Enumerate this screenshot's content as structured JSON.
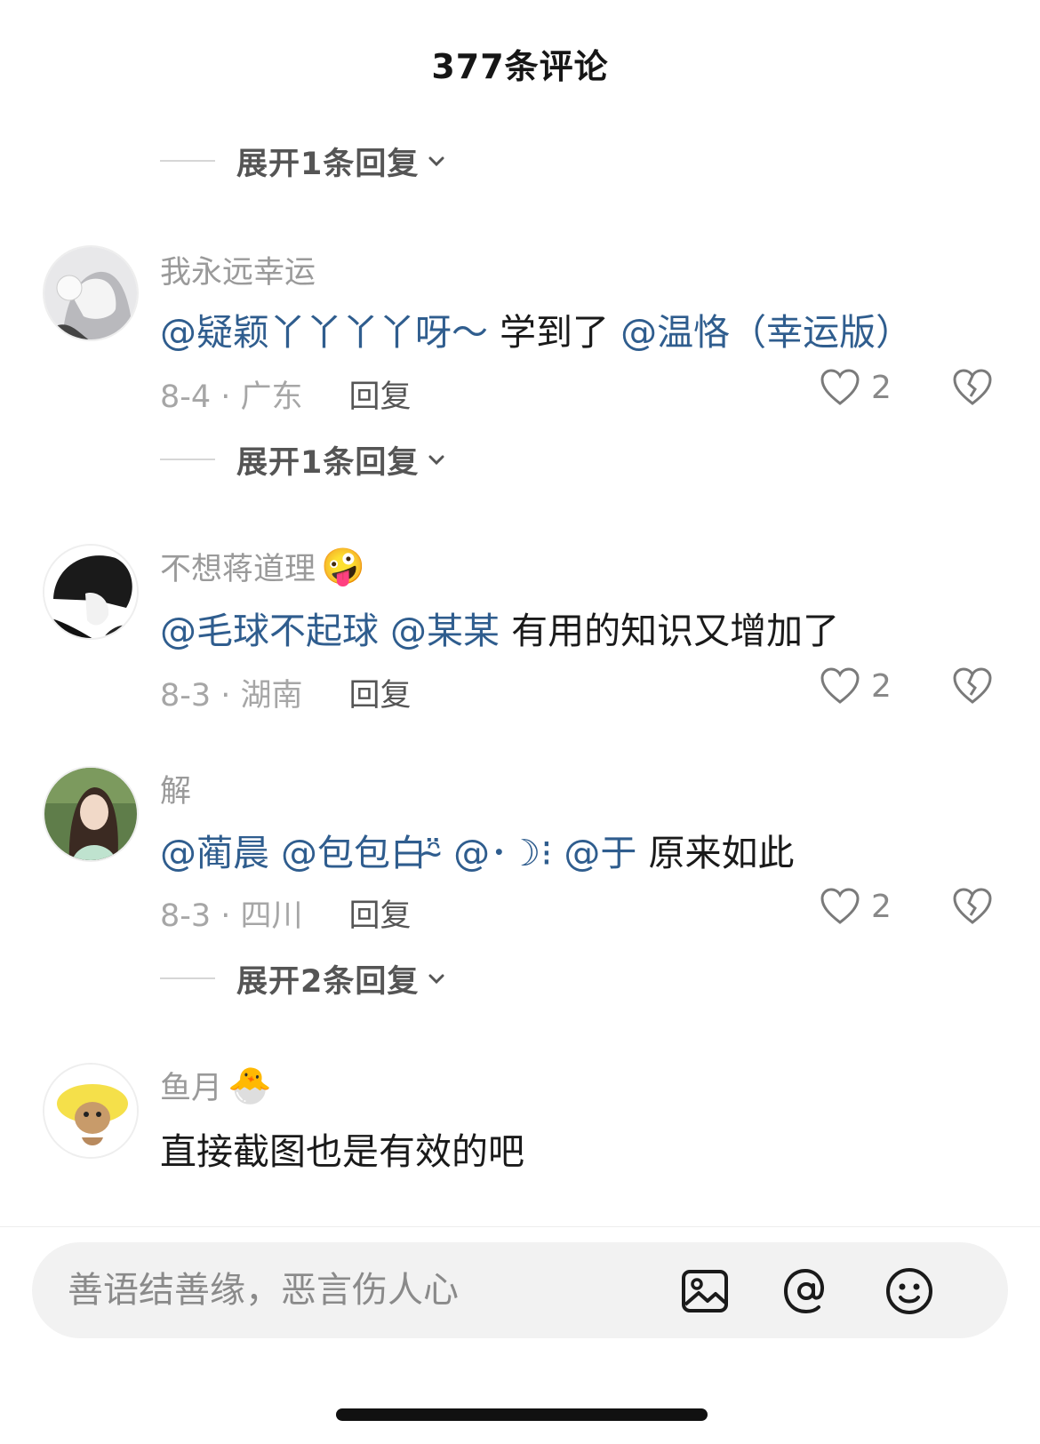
{
  "header": {
    "title": "377条评论"
  },
  "expand_replies": [
    {
      "label": "展开1条回复"
    },
    {
      "label": "展开1条回复"
    },
    {
      "label": "展开2条回复"
    }
  ],
  "comments": [
    {
      "username": "我永远幸运",
      "username_emoji": "",
      "mentions": [
        "@疑颖丫丫丫丫呀～",
        "@温恪（幸运版）"
      ],
      "text_middle": "学到了",
      "text_tail": "",
      "date_location": "8-4 · 广东",
      "reply_label": "回复",
      "likes": "2"
    },
    {
      "username": "不想蒋道理",
      "username_emoji": "🤪",
      "mentions": [
        "@毛球不起球",
        "@某某"
      ],
      "text_tail": "有用的知识又增加了",
      "date_location": "8-3 · 湖南",
      "reply_label": "回复",
      "likes": "2"
    },
    {
      "username": "解",
      "username_emoji": "",
      "mentions": [
        "@蔺晨",
        "@包包白ᵔ̴̈",
        "@･☽⁝",
        "@于"
      ],
      "text_tail": "原来如此",
      "date_location": "8-3 · 四川",
      "reply_label": "回复",
      "likes": "2"
    },
    {
      "username": "鱼月",
      "username_emoji": "🐣",
      "text": "直接截图也是有效的吧"
    }
  ],
  "input": {
    "placeholder": "善语结善缘，恶言伤人心"
  },
  "icons": {
    "image": "image-icon",
    "at": "at-icon",
    "emoji": "emoji-icon",
    "heart": "heart-icon",
    "dislike": "broken-heart-icon",
    "chevron": "chevron-down-icon"
  },
  "colors": {
    "mention": "#2f5d8e",
    "muted": "#a6a6a6"
  }
}
